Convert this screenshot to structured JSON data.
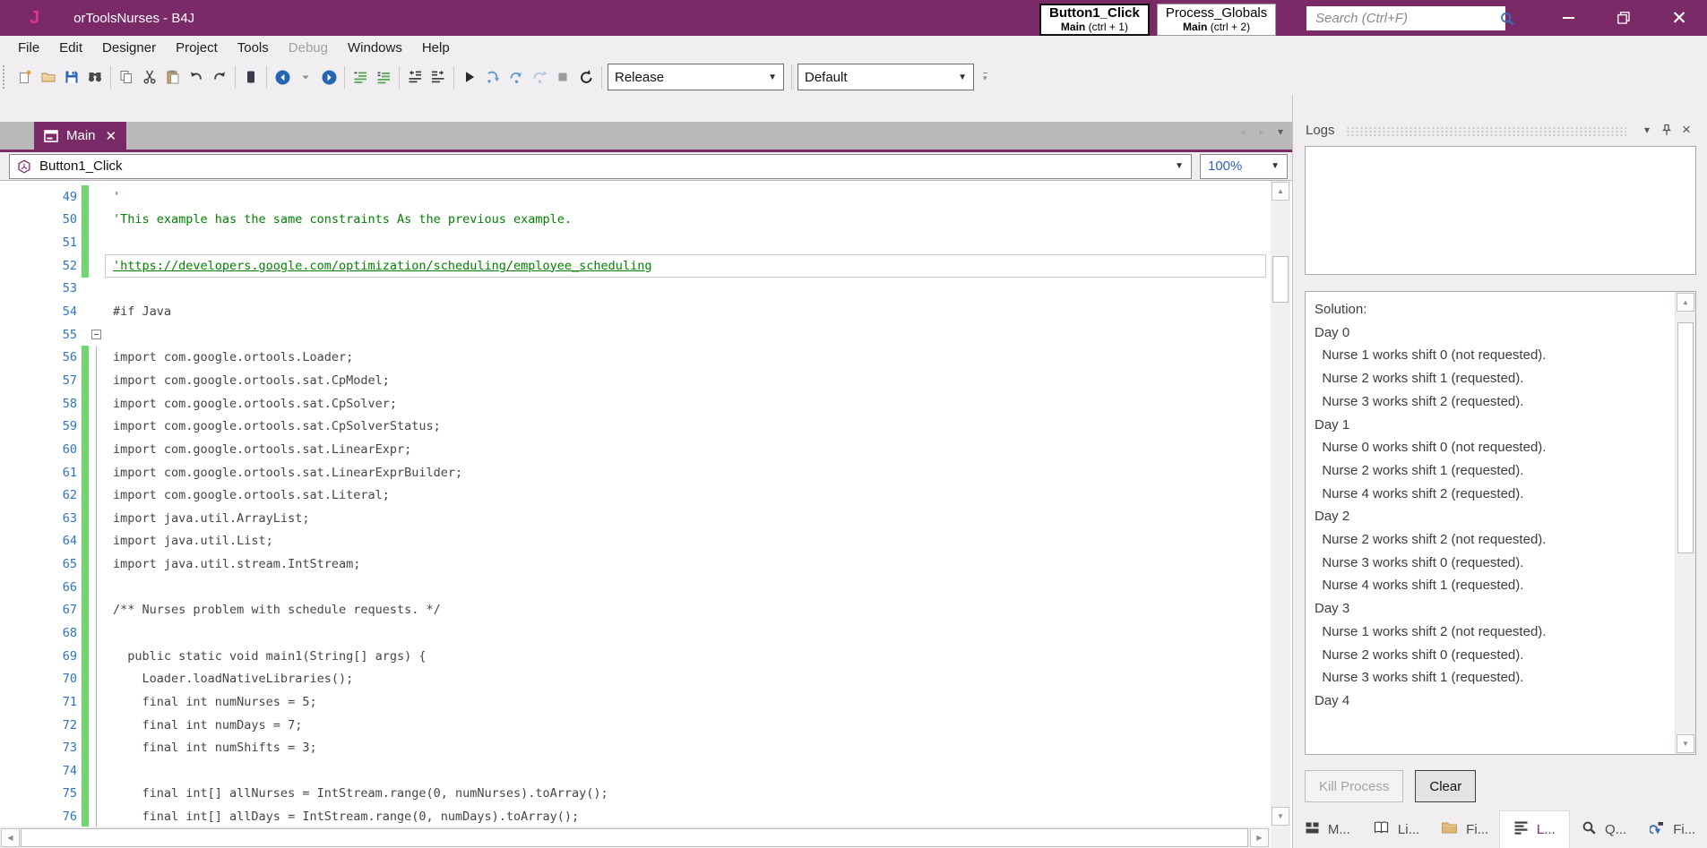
{
  "colors": {
    "titlebar": "#7b2a68",
    "accent_purple": "#7b2a68",
    "logo_pink": "#e0338f",
    "comment_green": "#008200",
    "line_number_blue": "#2f73be",
    "change_bar_green": "#70d670",
    "code_text": "#454545",
    "panel_bg": "#f0eef1"
  },
  "titlebar": {
    "logo_letter": "J",
    "title": "orToolsNurses - B4J",
    "quick_access_tabs": [
      {
        "name": "Button1_Click",
        "module": "Main",
        "shortcut": "(ctrl + 1)",
        "active": true
      },
      {
        "name": "Process_Globals",
        "module": "Main",
        "shortcut": "(ctrl + 2)",
        "active": false
      }
    ],
    "search": {
      "placeholder": "Search (Ctrl+F)",
      "icon": "search-icon"
    },
    "window_controls": [
      "minimize",
      "restore",
      "close"
    ]
  },
  "menu": {
    "items": [
      {
        "label": "File",
        "enabled": true
      },
      {
        "label": "Edit",
        "enabled": true
      },
      {
        "label": "Designer",
        "enabled": true
      },
      {
        "label": "Project",
        "enabled": true
      },
      {
        "label": "Tools",
        "enabled": true
      },
      {
        "label": "Debug",
        "enabled": false
      },
      {
        "label": "Windows",
        "enabled": true
      },
      {
        "label": "Help",
        "enabled": true
      }
    ]
  },
  "toolbar": {
    "groups": [
      [
        "new-module",
        "open-project",
        "save",
        "find"
      ],
      [
        "copy",
        "cut",
        "paste",
        "undo",
        "redo"
      ],
      [
        "bookmark"
      ],
      [
        "back",
        "back-menu",
        "forward"
      ],
      [
        "comment",
        "uncomment"
      ],
      [
        "outdent",
        "indent"
      ],
      [
        "run",
        "step-into",
        "step-over",
        "step-out",
        "stop",
        "rebuild"
      ]
    ],
    "run_config": "Release",
    "ui_config": "Default"
  },
  "document_tabs": {
    "tabs": [
      {
        "label": "Main",
        "icon": "form-icon",
        "active": true
      }
    ],
    "nav_icons": [
      "scroll-tabs-left",
      "scroll-tabs-right",
      "tab-list-menu"
    ]
  },
  "code_editor": {
    "nav_selector": "Button1_Click",
    "nav_selector_icon": "sub-hexagon-icon",
    "zoom_level": "100%",
    "lines": [
      {
        "n": 49,
        "text": "'",
        "kind": "comment",
        "changed": true
      },
      {
        "n": 50,
        "text": "'This example has the same constraints As the previous example.",
        "kind": "comment",
        "changed": true
      },
      {
        "n": 51,
        "text": "",
        "kind": "code",
        "changed": true
      },
      {
        "n": 52,
        "text": "'https://developers.google.com/optimization/scheduling/employee_scheduling",
        "kind": "link",
        "changed": true,
        "current": true
      },
      {
        "n": 53,
        "text": "",
        "kind": "code",
        "changed": false
      },
      {
        "n": 54,
        "text": "#if Java",
        "kind": "code",
        "changed": false
      },
      {
        "n": 55,
        "text": "",
        "kind": "code",
        "changed": false,
        "fold": "start"
      },
      {
        "n": 56,
        "text": "import com.google.ortools.Loader;",
        "kind": "code",
        "changed": true,
        "fold": "line"
      },
      {
        "n": 57,
        "text": "import com.google.ortools.sat.CpModel;",
        "kind": "code",
        "changed": true,
        "fold": "line"
      },
      {
        "n": 58,
        "text": "import com.google.ortools.sat.CpSolver;",
        "kind": "code",
        "changed": true,
        "fold": "line"
      },
      {
        "n": 59,
        "text": "import com.google.ortools.sat.CpSolverStatus;",
        "kind": "code",
        "changed": true,
        "fold": "line"
      },
      {
        "n": 60,
        "text": "import com.google.ortools.sat.LinearExpr;",
        "kind": "code",
        "changed": true,
        "fold": "line"
      },
      {
        "n": 61,
        "text": "import com.google.ortools.sat.LinearExprBuilder;",
        "kind": "code",
        "changed": true,
        "fold": "line"
      },
      {
        "n": 62,
        "text": "import com.google.ortools.sat.Literal;",
        "kind": "code",
        "changed": true,
        "fold": "line"
      },
      {
        "n": 63,
        "text": "import java.util.ArrayList;",
        "kind": "code",
        "changed": true,
        "fold": "line"
      },
      {
        "n": 64,
        "text": "import java.util.List;",
        "kind": "code",
        "changed": true,
        "fold": "line"
      },
      {
        "n": 65,
        "text": "import java.util.stream.IntStream;",
        "kind": "code",
        "changed": true,
        "fold": "line"
      },
      {
        "n": 66,
        "text": "",
        "kind": "code",
        "changed": true,
        "fold": "line"
      },
      {
        "n": 67,
        "text": "/** Nurses problem with schedule requests. */",
        "kind": "code",
        "changed": true,
        "fold": "line"
      },
      {
        "n": 68,
        "text": "",
        "kind": "code",
        "changed": true,
        "fold": "line"
      },
      {
        "n": 69,
        "text": "  public static void main1(String[] args) {",
        "kind": "code",
        "changed": true,
        "fold": "line"
      },
      {
        "n": 70,
        "text": "    Loader.loadNativeLibraries();",
        "kind": "code",
        "changed": true,
        "fold": "line"
      },
      {
        "n": 71,
        "text": "    final int numNurses = 5;",
        "kind": "code",
        "changed": true,
        "fold": "line"
      },
      {
        "n": 72,
        "text": "    final int numDays = 7;",
        "kind": "code",
        "changed": true,
        "fold": "line"
      },
      {
        "n": 73,
        "text": "    final int numShifts = 3;",
        "kind": "code",
        "changed": true,
        "fold": "line"
      },
      {
        "n": 74,
        "text": "",
        "kind": "code",
        "changed": true,
        "fold": "line"
      },
      {
        "n": 75,
        "text": "    final int[] allNurses = IntStream.range(0, numNurses).toArray();",
        "kind": "code",
        "changed": true,
        "fold": "line"
      },
      {
        "n": 76,
        "text": "    final int[] allDays = IntStream.range(0, numDays).toArray();",
        "kind": "code",
        "changed": true,
        "fold": "line"
      }
    ]
  },
  "logs_panel": {
    "title": "Logs",
    "header_icons": [
      "chevron-down",
      "pin",
      "close"
    ],
    "output_lines": [
      "Solution:",
      "Day 0",
      "  Nurse 1 works shift 0 (not requested).",
      "  Nurse 2 works shift 1 (requested).",
      "  Nurse 3 works shift 2 (requested).",
      "Day 1",
      "  Nurse 0 works shift 0 (not requested).",
      "  Nurse 2 works shift 1 (requested).",
      "  Nurse 4 works shift 2 (requested).",
      "Day 2",
      "  Nurse 2 works shift 2 (not requested).",
      "  Nurse 3 works shift 0 (requested).",
      "  Nurse 4 works shift 1 (requested).",
      "Day 3",
      "  Nurse 1 works shift 2 (not requested).",
      "  Nurse 2 works shift 0 (requested).",
      "  Nurse 3 works shift 1 (requested).",
      "Day 4"
    ],
    "buttons": {
      "kill": {
        "label": "Kill Process",
        "enabled": false
      },
      "clear": {
        "label": "Clear",
        "enabled": true
      }
    },
    "bottom_tabs": [
      {
        "label": "M...",
        "icon": "modules-icon",
        "active": false
      },
      {
        "label": "Li...",
        "icon": "libraries-icon",
        "active": false
      },
      {
        "label": "Fi...",
        "icon": "files-icon",
        "active": false
      },
      {
        "label": "L...",
        "icon": "logs-icon",
        "active": true
      },
      {
        "label": "Q...",
        "icon": "quick-search-icon",
        "active": false
      },
      {
        "label": "Fi...",
        "icon": "find-references-icon",
        "active": false
      }
    ]
  }
}
